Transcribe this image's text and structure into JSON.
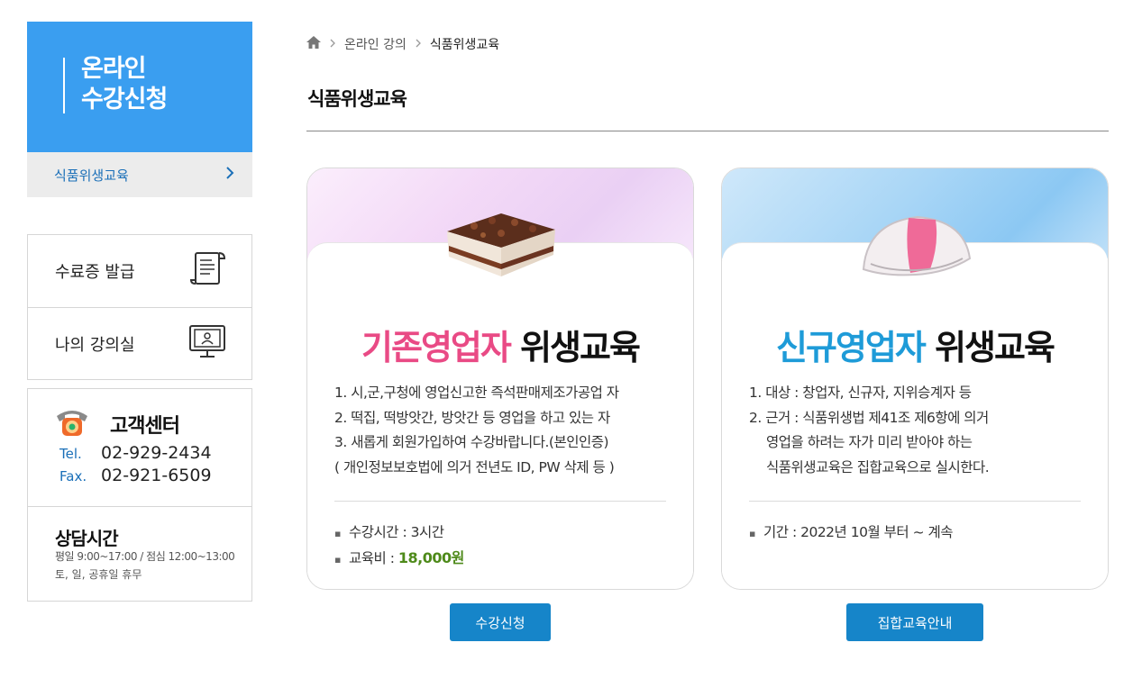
{
  "sidebar": {
    "head_title_line1": "온라인",
    "head_title_line2": "수강신청",
    "active_item": "식품위생교육",
    "menu": [
      {
        "label": "수료증 발급",
        "icon": "certificate-scroll-icon"
      },
      {
        "label": "나의 강의실",
        "icon": "monitor-user-icon"
      }
    ],
    "customer_center": {
      "title": "고객센터",
      "tel_label": "Tel.",
      "tel": "02-929-2434",
      "fax_label": "Fax.",
      "fax": "02-921-6509",
      "hours_title": "상담시간",
      "hours_line1": "평일 9:00~17:00 / 점심 12:00~13:00",
      "hours_line2": "토, 일, 공휴일 휴무"
    }
  },
  "breadcrumb": {
    "home_icon": "home-icon",
    "items": [
      "온라인 강의",
      "식품위생교육"
    ]
  },
  "page_title": "식품위생교육",
  "cards": [
    {
      "title_accent": "기존영업자",
      "title_rest": " 위생교육",
      "accent_color": "#e94a85",
      "desc": [
        "1. 시,군,구청에 영업신고한 즉석판매제조가공업 자",
        "2. 떡집, 떡방앗간, 방앗간 등 영업을 하고 있는 자",
        "3. 새롭게 회원가입하여 수강바랍니다.(본인인증)",
        "( 개인정보보호법에 의거 전년도 ID, PW 삭제 등 )"
      ],
      "info_time": "수강시간 : 3시간",
      "info_fee_label": "교육비 : ",
      "info_fee": "18,000원",
      "button": "수강신청"
    },
    {
      "title_accent": "신규영업자",
      "title_rest": " 위생교육",
      "accent_color": "#1e9bd8",
      "desc": [
        "1. 대상 : 창업자, 신규자, 지위승계자 등",
        "2. 근거 : 식품위생법 제41조 제6항에 의거",
        "영업을 하려는 자가 미리 받아야 하는",
        "식품위생교육은 집합교육으로 실시한다."
      ],
      "info_period": "기간 : 2022년 10월 부터 ~ 계속",
      "button": "집합교육안내"
    }
  ]
}
